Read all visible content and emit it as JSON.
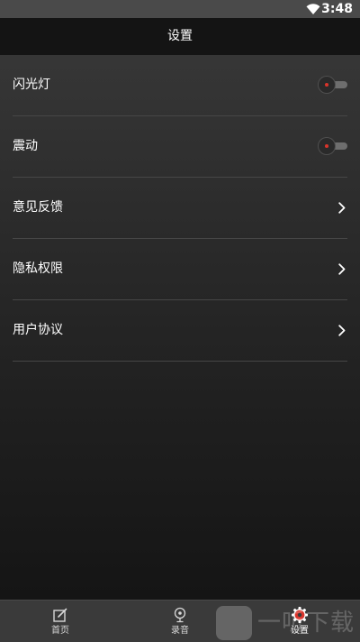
{
  "status_bar": {
    "time": "3:48",
    "wifi_icon": "wifi-icon"
  },
  "header": {
    "title": "设置"
  },
  "settings": {
    "items": [
      {
        "label": "闪光灯",
        "control": "toggle",
        "enabled": false
      },
      {
        "label": "震动",
        "control": "toggle",
        "enabled": false
      },
      {
        "label": "意见反馈",
        "control": "chevron-right-icon"
      },
      {
        "label": "隐私权限",
        "control": "chevron-right-icon"
      },
      {
        "label": "用户协议",
        "control": "chevron-right-icon"
      }
    ]
  },
  "bottom_nav": {
    "items": [
      {
        "label": "首页",
        "icon": "edit-icon",
        "active": false
      },
      {
        "label": "录音",
        "icon": "microphone-icon",
        "active": false
      },
      {
        "label": "设置",
        "icon": "gear-icon",
        "active": true
      }
    ]
  },
  "watermark": {
    "text": "一听下载"
  },
  "colors": {
    "toggle_dot": "#d9342b",
    "title_bar": "#141414",
    "status_bar": "#4a4a4a",
    "nav_bar": "#3a3a3a",
    "divider": "#464646"
  }
}
